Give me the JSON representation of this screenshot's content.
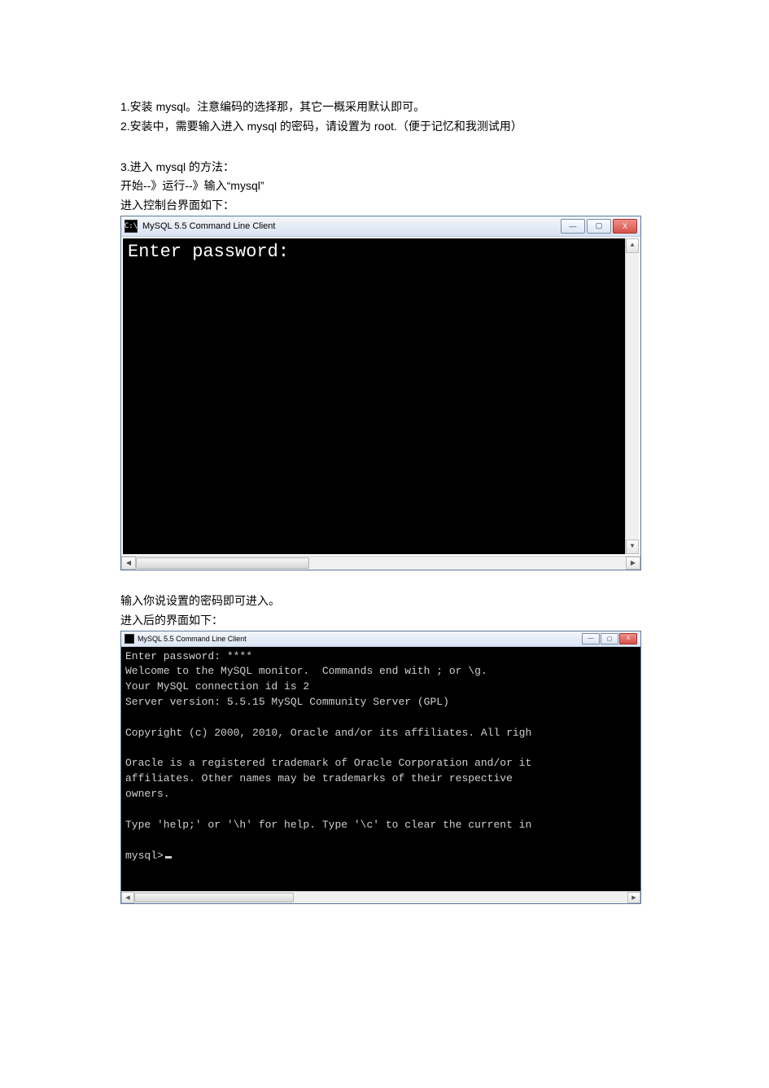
{
  "doc": {
    "line1": "1.安装 mysql。注意编码的选择那，其它一概采用默认即可。",
    "line2": "2.安装中，需要输入进入 mysql 的密码，请设置为 root.（便于记忆和我测试用）",
    "line3": "3.进入 mysql 的方法：",
    "line4": "开始--》运行--》输入“mysql”",
    "line5": "进入控制台界面如下：",
    "line6": "输入你说设置的密码即可进入。",
    "line7": "进入后的界面如下："
  },
  "win1": {
    "title": "MySQL 5.5 Command Line Client",
    "icon_text": "C:\\",
    "content": "Enter password:",
    "btn_min": "—",
    "btn_max": "▢",
    "btn_close": "X",
    "arrow_up": "▲",
    "arrow_down": "▼",
    "arrow_left": "◀",
    "arrow_right": "▶"
  },
  "win2": {
    "title": "MySQL 5.5 Command Line Client",
    "lines": [
      "Enter password: ****",
      "Welcome to the MySQL monitor.  Commands end with ; or \\g.",
      "Your MySQL connection id is 2",
      "Server version: 5.5.15 MySQL Community Server (GPL)",
      "",
      "Copyright (c) 2000, 2010, Oracle and/or its affiliates. All righ",
      "",
      "Oracle is a registered trademark of Oracle Corporation and/or it",
      "affiliates. Other names may be trademarks of their respective",
      "owners.",
      "",
      "Type 'help;' or '\\h' for help. Type '\\c' to clear the current in",
      "",
      "mysql>"
    ],
    "btn_min": "—",
    "btn_max": "▢",
    "btn_close": "X",
    "arrow_left": "◀",
    "arrow_right": "▶"
  }
}
